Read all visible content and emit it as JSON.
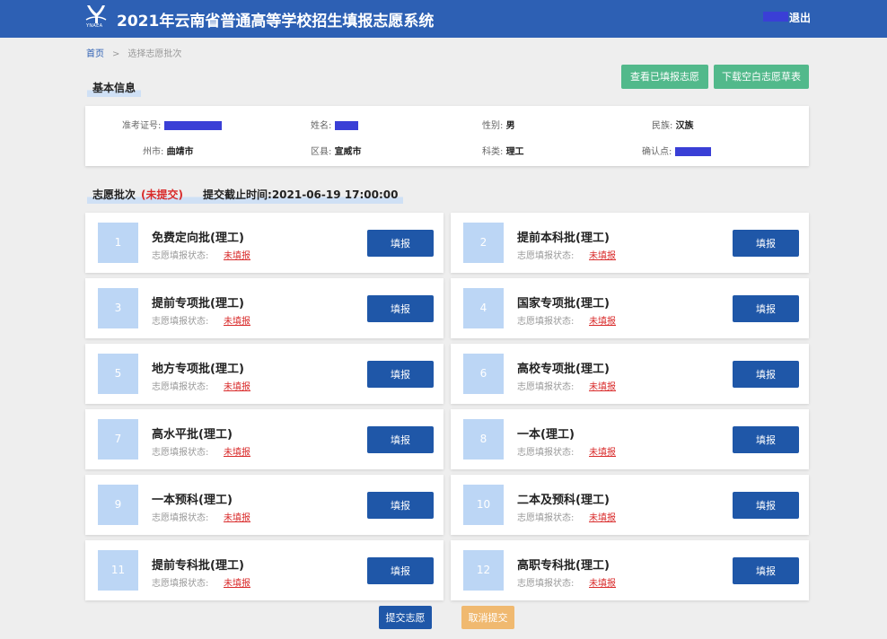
{
  "header": {
    "logo_text": "YNAEA",
    "title": "2021年云南省普通高等学校招生填报志愿系统",
    "logout_label": "退出"
  },
  "breadcrumb": {
    "home": "首页",
    "separator": ">",
    "current": "选择志愿批次"
  },
  "basic_info": {
    "section_title": "基本信息",
    "view_button": "查看已填报志愿",
    "download_button": "下载空白志愿草表",
    "fields": {
      "exam_no_label": "准考证号:",
      "name_label": "姓名:",
      "gender_label": "性别:",
      "gender_value": "男",
      "ethnicity_label": "民族:",
      "ethnicity_value": "汉族",
      "city_label": "州市:",
      "city_value": "曲靖市",
      "county_label": "区县:",
      "county_value": "宣威市",
      "subject_label": "科类:",
      "subject_value": "理工",
      "confirm_label": "确认点:"
    }
  },
  "batch": {
    "section_title": "志愿批次",
    "status": "(未提交)",
    "deadline_label": "提交截止时间:",
    "deadline_value": "2021-06-19 17:00:00",
    "state_label": "志愿填报状态:",
    "fill_label": "填报",
    "items": [
      {
        "num": "1",
        "name": "免费定向批(理工)",
        "state": "未填报"
      },
      {
        "num": "2",
        "name": "提前本科批(理工)",
        "state": "未填报"
      },
      {
        "num": "3",
        "name": "提前专项批(理工)",
        "state": "未填报"
      },
      {
        "num": "4",
        "name": "国家专项批(理工)",
        "state": "未填报"
      },
      {
        "num": "5",
        "name": "地方专项批(理工)",
        "state": "未填报"
      },
      {
        "num": "6",
        "name": "高校专项批(理工)",
        "state": "未填报"
      },
      {
        "num": "7",
        "name": "高水平批(理工)",
        "state": "未填报"
      },
      {
        "num": "8",
        "name": "一本(理工)",
        "state": "未填报"
      },
      {
        "num": "9",
        "name": "一本预科(理工)",
        "state": "未填报"
      },
      {
        "num": "10",
        "name": "二本及预科(理工)",
        "state": "未填报"
      },
      {
        "num": "11",
        "name": "提前专科批(理工)",
        "state": "未填报"
      },
      {
        "num": "12",
        "name": "高职专科批(理工)",
        "state": "未填报"
      }
    ]
  },
  "actions": {
    "submit_label": "提交志愿",
    "cancel_label": "取消提交"
  },
  "colors": {
    "header_bg": "#2d60b4",
    "primary_button": "#1f57a8",
    "green_button": "#52b98b",
    "cancel_button": "#f0b970",
    "unfilled_state": "#d92b2b",
    "number_tile": "#bcd6f5",
    "redaction": "#3a3fd6"
  }
}
